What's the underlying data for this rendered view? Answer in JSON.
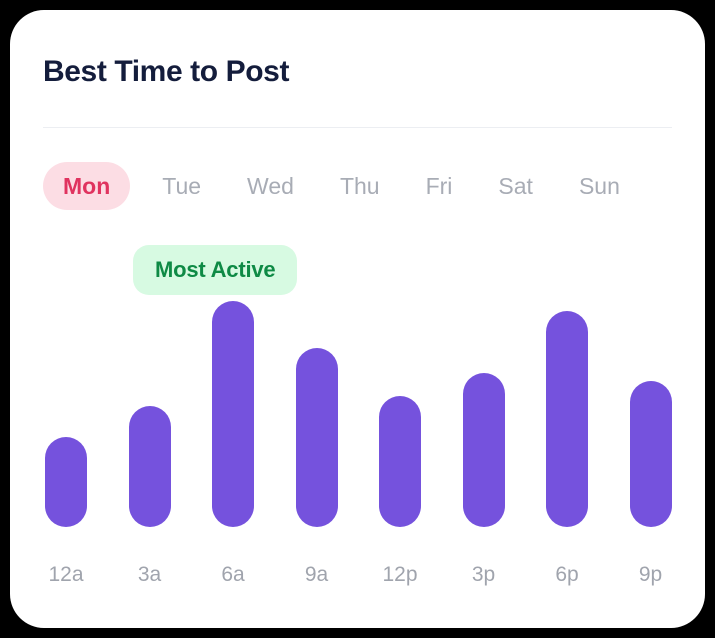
{
  "card": {
    "title": "Best Time to Post"
  },
  "day_tabs": {
    "selected": "Mon",
    "items": [
      {
        "label": "Mon",
        "active": true
      },
      {
        "label": "Tue",
        "active": false
      },
      {
        "label": "Wed",
        "active": false
      },
      {
        "label": "Thu",
        "active": false
      },
      {
        "label": "Fri",
        "active": false
      },
      {
        "label": "Sat",
        "active": false
      },
      {
        "label": "Sun",
        "active": false
      }
    ]
  },
  "badge": {
    "label": "Most Active"
  },
  "colors": {
    "bar": "#7552dd",
    "badge_bg": "#d7fae2",
    "badge_text": "#0e8a45",
    "tab_active_bg": "#fcdde4",
    "tab_active_text": "#e0335f",
    "title": "#141d3c",
    "tick_label": "#a0a4ad",
    "card_bg": "#ffffff",
    "page_bg": "#000000"
  },
  "chart_data": {
    "type": "bar",
    "title": "Best Time to Post",
    "xlabel": "",
    "ylabel": "",
    "grid": false,
    "legend": "none",
    "categories": [
      "12a",
      "3a",
      "6a",
      "9a",
      "12p",
      "3p",
      "6p",
      "9p"
    ],
    "values": [
      90,
      121,
      226,
      179,
      131,
      154,
      216,
      146
    ],
    "ylim": [
      0,
      240
    ],
    "annotations": [
      {
        "text": "Most Active",
        "category": "6a"
      }
    ]
  }
}
